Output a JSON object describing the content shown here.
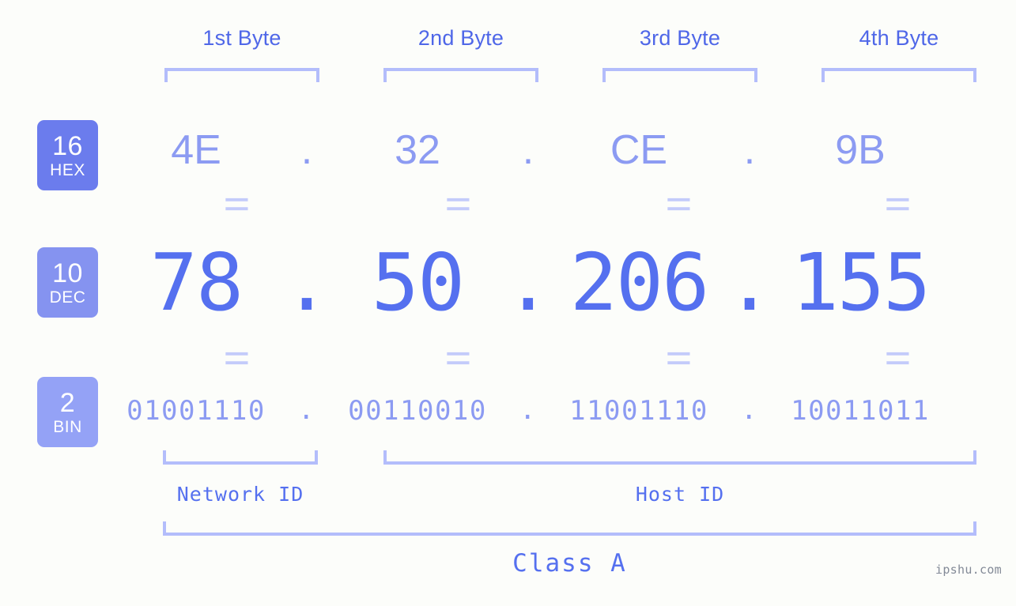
{
  "meta": {
    "watermark": "ipshu.com",
    "background_color": "#fcfdfa",
    "accent_color": "#5570ef",
    "light_accent_color": "#8c9bf2",
    "bracket_color": "#b3bdfb"
  },
  "byte_headers": [
    {
      "label": "1st Byte"
    },
    {
      "label": "2nd Byte"
    },
    {
      "label": "3rd Byte"
    },
    {
      "label": "4th Byte"
    }
  ],
  "bases": [
    {
      "id": "hex",
      "number": "16",
      "name": "HEX",
      "color": "#6b7ced"
    },
    {
      "id": "dec",
      "number": "10",
      "name": "DEC",
      "color": "#8593f0"
    },
    {
      "id": "bin",
      "number": "2",
      "name": "BIN",
      "color": "#94a2f6"
    }
  ],
  "rows": {
    "hex": {
      "separator": ".",
      "values": [
        "4E",
        "32",
        "CE",
        "9B"
      ]
    },
    "dec": {
      "separator": ".",
      "values": [
        "78",
        "50",
        "206",
        "155"
      ]
    },
    "bin": {
      "separator": ".",
      "values": [
        "01001110",
        "00110010",
        "11001110",
        "10011011"
      ]
    }
  },
  "equals_marks": {
    "symbol": "||",
    "count_per_gap": 4,
    "gaps": 2
  },
  "segments": {
    "network_id": {
      "label": "Network ID"
    },
    "host_id": {
      "label": "Host ID"
    },
    "class": {
      "label": "Class A"
    }
  }
}
